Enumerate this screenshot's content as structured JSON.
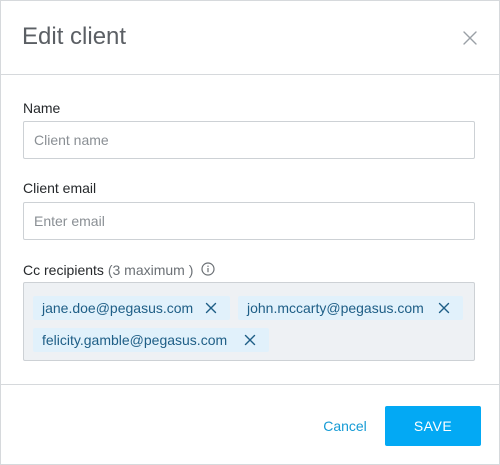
{
  "dialog": {
    "title": "Edit client",
    "close_icon": "close-icon"
  },
  "form": {
    "name_label": "Name",
    "name_placeholder": "Client name",
    "name_value": "",
    "email_label": "Client email",
    "email_placeholder": "Enter email",
    "email_value": "",
    "cc_label": "Cc recipients",
    "cc_hint": "(3 maximum )",
    "cc_info_icon": "info-icon",
    "cc_recipients": [
      "jane.doe@pegasus.com",
      "john.mccarty@pegasus.com",
      "felicity.gamble@pegasus.com"
    ],
    "chip_remove_icon": "close-icon"
  },
  "footer": {
    "cancel_label": "Cancel",
    "save_label": "SAVE"
  },
  "colors": {
    "accent": "#03a9f4",
    "link": "#169bd5",
    "chip_bg": "#e1f1fb",
    "chip_text": "#1e5e86",
    "cc_box_bg": "#eef1f4",
    "border": "#d6d9dc"
  }
}
